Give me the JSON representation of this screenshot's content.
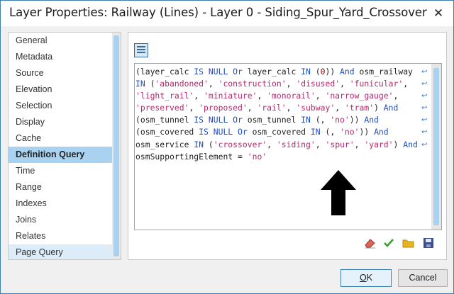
{
  "window": {
    "title": "Layer Properties: Railway (Lines) - Layer 0 - Siding_Spur_Yard_Crossover",
    "close_glyph": "✕"
  },
  "nav": {
    "items": [
      {
        "label": "General",
        "state": "normal"
      },
      {
        "label": "Metadata",
        "state": "normal"
      },
      {
        "label": "Source",
        "state": "normal"
      },
      {
        "label": "Elevation",
        "state": "normal"
      },
      {
        "label": "Selection",
        "state": "normal"
      },
      {
        "label": "Display",
        "state": "normal"
      },
      {
        "label": "Cache",
        "state": "normal"
      },
      {
        "label": "Definition Query",
        "state": "selected"
      },
      {
        "label": "Time",
        "state": "normal"
      },
      {
        "label": "Range",
        "state": "normal"
      },
      {
        "label": "Indexes",
        "state": "normal"
      },
      {
        "label": "Joins",
        "state": "normal"
      },
      {
        "label": "Relates",
        "state": "normal"
      },
      {
        "label": "Page Query",
        "state": "partial"
      }
    ]
  },
  "query": {
    "lines": [
      [
        [
          "p",
          "("
        ],
        [
          "t",
          "layer_calc "
        ],
        [
          "k",
          "IS NULL Or "
        ],
        [
          "t",
          "layer_calc "
        ],
        [
          "k",
          "IN "
        ],
        [
          "p",
          "("
        ],
        [
          "n",
          "0"
        ],
        [
          "p",
          ")) "
        ],
        [
          "k",
          "And "
        ],
        [
          "t",
          "osm_railway"
        ]
      ],
      [
        [
          "k",
          "IN "
        ],
        [
          "p",
          "("
        ],
        [
          "s",
          "'abandoned'"
        ],
        [
          "p",
          ", "
        ],
        [
          "s",
          "'construction'"
        ],
        [
          "p",
          ", "
        ],
        [
          "s",
          "'disused'"
        ],
        [
          "p",
          ", "
        ],
        [
          "s",
          "'funicular'"
        ],
        [
          "p",
          ","
        ]
      ],
      [
        [
          "s",
          "'light_rail'"
        ],
        [
          "p",
          ", "
        ],
        [
          "s",
          "'miniature'"
        ],
        [
          "p",
          ", "
        ],
        [
          "s",
          "'monorail'"
        ],
        [
          "p",
          ", "
        ],
        [
          "s",
          "'narrow_gauge'"
        ],
        [
          "p",
          ","
        ]
      ],
      [
        [
          "s",
          "'preserved'"
        ],
        [
          "p",
          ", "
        ],
        [
          "s",
          "'proposed'"
        ],
        [
          "p",
          ", "
        ],
        [
          "s",
          "'rail'"
        ],
        [
          "p",
          ", "
        ],
        [
          "s",
          "'subway'"
        ],
        [
          "p",
          ", "
        ],
        [
          "s",
          "'tram'"
        ],
        [
          "p",
          ") "
        ],
        [
          "k",
          "And"
        ]
      ],
      [
        [
          "p",
          "("
        ],
        [
          "t",
          "osm_tunnel "
        ],
        [
          "k",
          "IS NULL Or "
        ],
        [
          "t",
          "osm_tunnel "
        ],
        [
          "k",
          "IN "
        ],
        [
          "p",
          "(, "
        ],
        [
          "s",
          "'no'"
        ],
        [
          "p",
          ")) "
        ],
        [
          "k",
          "And"
        ]
      ],
      [
        [
          "p",
          "("
        ],
        [
          "t",
          "osm_covered "
        ],
        [
          "k",
          "IS NULL Or "
        ],
        [
          "t",
          "osm_covered "
        ],
        [
          "k",
          "IN "
        ],
        [
          "p",
          "(, "
        ],
        [
          "s",
          "'no'"
        ],
        [
          "p",
          ")) "
        ],
        [
          "k",
          "And"
        ]
      ],
      [
        [
          "t",
          "osm_service "
        ],
        [
          "k",
          "IN "
        ],
        [
          "p",
          "("
        ],
        [
          "s",
          "'crossover'"
        ],
        [
          "p",
          ", "
        ],
        [
          "s",
          "'siding'"
        ],
        [
          "p",
          ", "
        ],
        [
          "s",
          "'spur'"
        ],
        [
          "p",
          ", "
        ],
        [
          "s",
          "'yard'"
        ],
        [
          "p",
          ") "
        ],
        [
          "k",
          "And"
        ]
      ],
      [
        [
          "t",
          "osmSupportingElement "
        ],
        [
          "p",
          "= "
        ],
        [
          "s",
          "'no'"
        ]
      ]
    ],
    "wrap_marker": "↩",
    "wrap_marker_lines": 7
  },
  "toolbar": {
    "icons": [
      "eraser-icon",
      "check-icon",
      "folder-icon",
      "save-icon"
    ],
    "colors": {
      "check": "#3a9e2f",
      "folder": "#e6b422",
      "save": "#3b4d8c",
      "eraser": "#d9645a"
    }
  },
  "buttons": {
    "ok_label": "OK",
    "cancel_label": "Cancel"
  }
}
